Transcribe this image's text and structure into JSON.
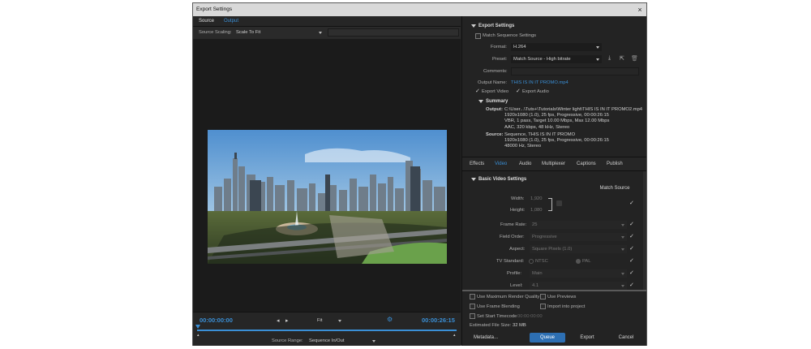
{
  "window": {
    "title": "Export Settings",
    "close": "×"
  },
  "left": {
    "tabs": [
      "Source",
      "Output"
    ],
    "scaling_label": "Source Scaling:",
    "scaling_value": "Scale To Fit",
    "timecode_start": "00:00:00:00",
    "fit_value": "Fit",
    "timecode_end": "00:00:26:15",
    "source_range_label": "Source Range:",
    "source_range_value": "Sequence In/Out"
  },
  "right": {
    "export_settings_title": "Export Settings",
    "match_sequence": "Match Sequence Settings",
    "format_label": "Format:",
    "format_value": "H.264",
    "preset_label": "Preset:",
    "preset_value": "Match Source - High bitrate",
    "comments_label": "Comments:",
    "output_name_label": "Output Name:",
    "output_name_value": "THIS IS IN IT PROMO.mp4",
    "export_video": "Export Video",
    "export_audio": "Export Audio",
    "summary_title": "Summary",
    "output_label": "Output:",
    "output_lines": [
      "C:\\User...\\Tuts+\\Tutorials\\Winter light\\THIS IS IN IT PROMO2.mp4",
      "1920x1080 (1.0), 25 fps, Progressive, 00:00:26:15",
      "VBR, 1 pass, Target 10.00 Mbps, Max 12.00 Mbps",
      "AAC, 320 kbps, 48 kHz, Stereo"
    ],
    "source_label": "Source:",
    "source_lines": [
      "Sequence, THIS IS IN IT PROMO",
      "1920x1080 (1.0), 25 fps, Progressive, 00:00:26:15",
      "48000 Hz, Stereo"
    ],
    "tabs": [
      "Effects",
      "Video",
      "Audio",
      "Multiplexer",
      "Captions",
      "Publish"
    ],
    "basic_video_title": "Basic Video Settings",
    "match_source_btn": "Match Source",
    "width_label": "Width:",
    "width_value": "1,920",
    "height_label": "Height:",
    "height_value": "1,080",
    "frame_rate_label": "Frame Rate:",
    "frame_rate_value": "25",
    "field_order_label": "Field Order:",
    "field_order_value": "Progressive",
    "aspect_label": "Aspect:",
    "aspect_value": "Square Pixels (1.0)",
    "tv_standard_label": "TV Standard:",
    "ntsc": "NTSC",
    "pal": "PAL",
    "profile_label": "Profile:",
    "profile_value": "Main",
    "level_label": "Level:",
    "level_value": "4.1",
    "use_max_render": "Use Maximum Render Quality",
    "use_previews": "Use Previews",
    "use_frame_blending": "Use Frame Blending",
    "import_into_project": "Import into project",
    "set_start_timecode": "Set Start Timecode",
    "start_timecode_value": "00:00:00:00",
    "est_file_size_label": "Estimated File Size:",
    "est_file_size_value": "32 MB",
    "metadata_btn": "Metadata...",
    "queue_btn": "Queue",
    "export_btn": "Export",
    "cancel_btn": "Cancel"
  },
  "colors": {
    "accent": "#3a8fd6",
    "panel": "#232323",
    "queue": "#2d6fb3"
  }
}
